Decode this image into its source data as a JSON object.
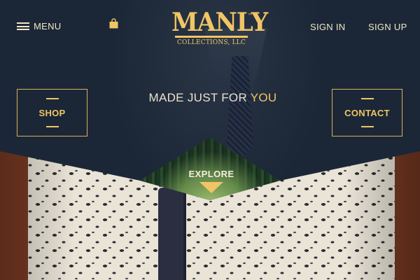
{
  "header": {
    "menu_label": "MENU",
    "cart_icon": "shopping-bag-icon",
    "logo": {
      "brand": "MANLY",
      "trademark": "™",
      "subtitle": "COLLECTIONS, LLC"
    },
    "sign_in_label": "SIGN IN",
    "sign_up_label": "SIGN UP"
  },
  "hero": {
    "tagline_prefix": "MADE JUST FOR ",
    "tagline_highlight": "YOU",
    "shop_label": "SHOP",
    "contact_label": "CONTACT",
    "explore_label": "EXPLORE"
  },
  "colors": {
    "accent": "#f0c565",
    "dark_navy": "#1b2737",
    "cream_text": "#f1e6c6"
  }
}
